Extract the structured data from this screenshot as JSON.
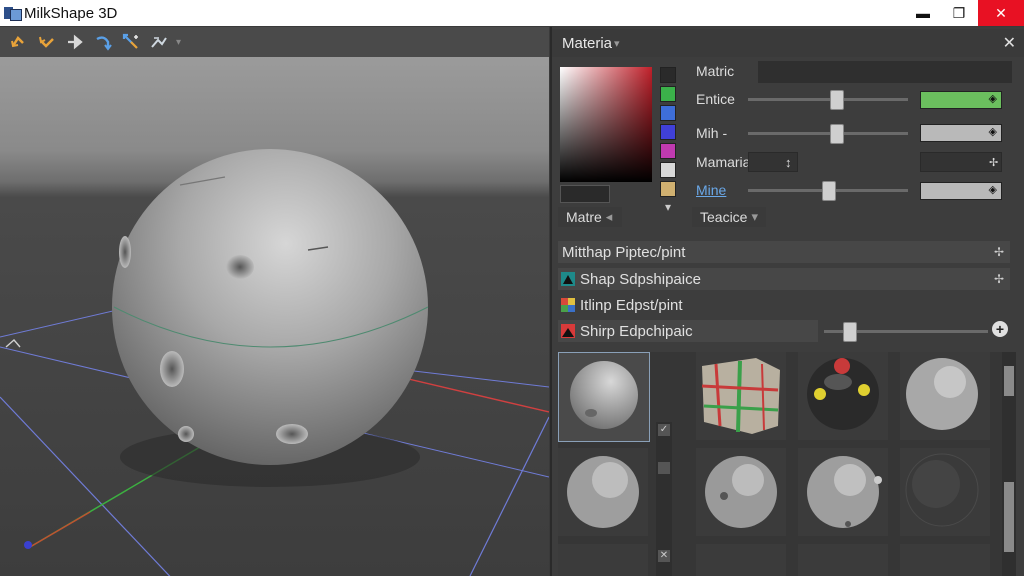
{
  "window": {
    "title": "MilkShape 3D",
    "min_label": "▬",
    "max_label": "❐",
    "close_label": "✕"
  },
  "toolbar": {
    "tools": [
      "rotate-left-icon",
      "rotate-right-icon",
      "move-icon",
      "redo-icon",
      "select-icon",
      "scale-icon"
    ],
    "dropdown_label": "▾"
  },
  "panel": {
    "title": "Materia",
    "title_suffix": "▾",
    "close_label": "✕",
    "material_label": "Matric",
    "entice_label": "Entice",
    "mih_label": "Mih -",
    "mamaria_label": "Mamaria",
    "mamaria_arrow": "↕",
    "mine_label": "Mine",
    "matre_label": "Matre",
    "matre_arrow": "◂",
    "teacice_label": "Teacice",
    "teacice_arrow": "▾",
    "swatch_arrow": "▾",
    "sliders": {
      "entice": 0.55,
      "mih": 0.55,
      "mine": 0.5
    },
    "colors": {
      "accent_green": "#6bbf5e",
      "value_gray": "#b9b9b9"
    },
    "swatches": [
      "#2a2a2a",
      "#3bb14a",
      "#3e6ed8",
      "#4040d8",
      "#c03ab0",
      "#d8d8d8",
      "#d0b070"
    ],
    "rows": [
      {
        "label": "Mitthap Piptec/pint",
        "pin": "✢",
        "icon": "none"
      },
      {
        "label": "Shap Sdpshipaice",
        "pin": "✢",
        "icon": "cube-icon"
      },
      {
        "label": "Itlinp Edpst/pint",
        "pin": "",
        "icon": "tiles-icon"
      },
      {
        "label": "Shirp Edpchipaic",
        "pin": "",
        "icon": "shape-icon"
      }
    ],
    "row4_add": "+",
    "row4_slider": 0.15,
    "grid_check_1": "✓",
    "grid_check_2": "✕"
  }
}
